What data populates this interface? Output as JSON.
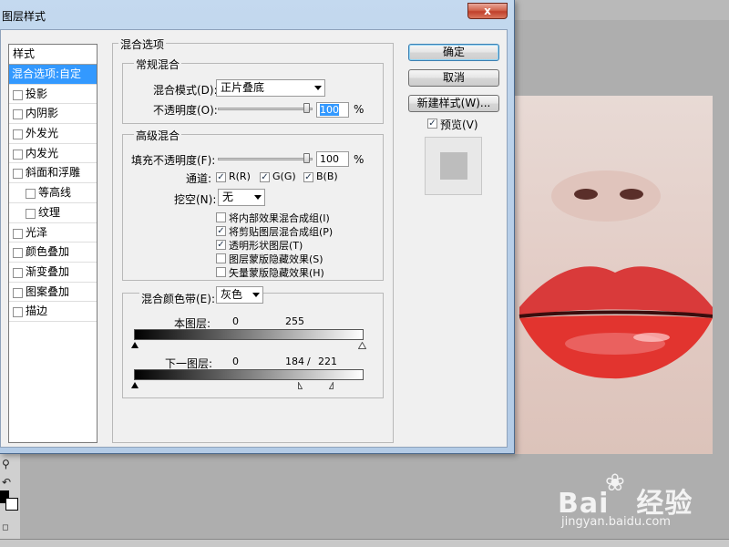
{
  "window": {
    "title": "图层样式",
    "close_glyph": "x"
  },
  "styles": {
    "header": "样式",
    "selected": "混合选项:自定",
    "items": [
      {
        "label": "投影",
        "checked": false,
        "sub": false
      },
      {
        "label": "内阴影",
        "checked": false,
        "sub": false
      },
      {
        "label": "外发光",
        "checked": false,
        "sub": false
      },
      {
        "label": "内发光",
        "checked": false,
        "sub": false
      },
      {
        "label": "斜面和浮雕",
        "checked": false,
        "sub": false
      },
      {
        "label": "等高线",
        "checked": false,
        "sub": true
      },
      {
        "label": "纹理",
        "checked": false,
        "sub": true
      },
      {
        "label": "光泽",
        "checked": false,
        "sub": false
      },
      {
        "label": "颜色叠加",
        "checked": false,
        "sub": false
      },
      {
        "label": "渐变叠加",
        "checked": false,
        "sub": false
      },
      {
        "label": "图案叠加",
        "checked": false,
        "sub": false
      },
      {
        "label": "描边",
        "checked": false,
        "sub": false
      }
    ]
  },
  "blending": {
    "section_title": "混合选项",
    "general": {
      "title": "常规混合",
      "mode_label": "混合模式(D):",
      "mode_value": "正片叠底",
      "opacity_label": "不透明度(O):",
      "opacity_value": "100",
      "percent": "%"
    },
    "advanced": {
      "title": "高级混合",
      "fill_opacity_label": "填充不透明度(F):",
      "fill_opacity_value": "100",
      "percent": "%",
      "channels_label": "通道:",
      "channel_r": "R(R)",
      "channel_g": "G(G)",
      "channel_b": "B(B)",
      "knockout_label": "挖空(N):",
      "knockout_value": "无",
      "options": [
        {
          "label": "将内部效果混合成组(I)",
          "checked": false
        },
        {
          "label": "将剪贴图层混合成组(P)",
          "checked": true
        },
        {
          "label": "透明形状图层(T)",
          "checked": true
        },
        {
          "label": "图层蒙版隐藏效果(S)",
          "checked": false
        },
        {
          "label": "矢量蒙版隐藏效果(H)",
          "checked": false
        }
      ]
    },
    "blend_if": {
      "label": "混合颜色带(E):",
      "value": "灰色",
      "this_layer_label": "本图层:",
      "this_layer_min": "0",
      "this_layer_max": "255",
      "underlying_label": "下一图层:",
      "underlying_min": "0",
      "underlying_split_low": "184",
      "underlying_sep": "/",
      "underlying_split_high": "221"
    }
  },
  "buttons": {
    "ok": "确定",
    "cancel": "取消",
    "new_style": "新建样式(W)...",
    "preview_label": "预览(V)",
    "preview_checked": true
  },
  "watermark": {
    "logo": "Bai",
    "logo_suffix": "经验",
    "url": "jingyan.baidu.com"
  },
  "check_glyph": "✓"
}
